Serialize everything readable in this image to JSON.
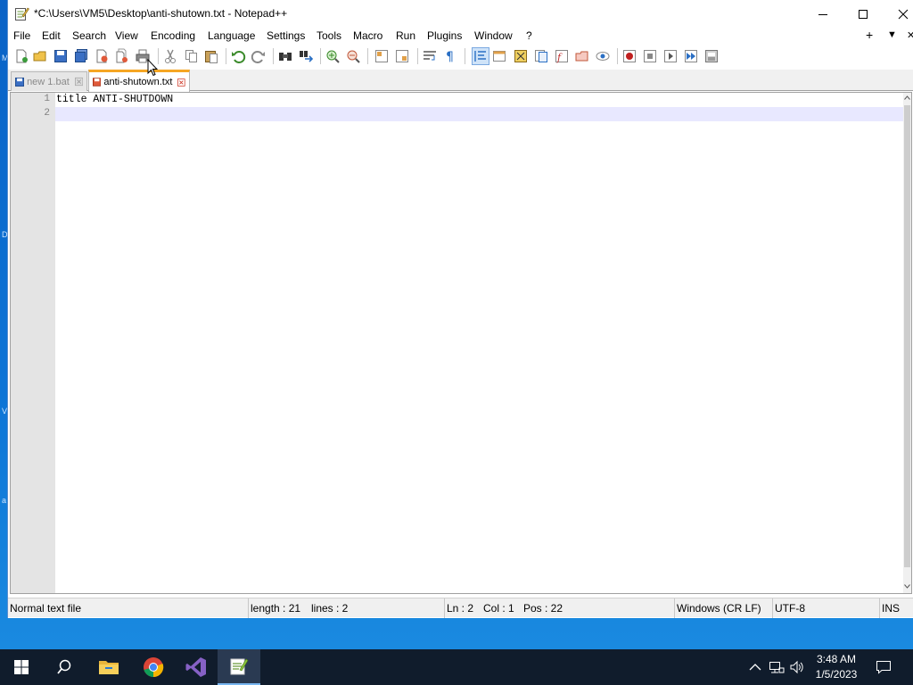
{
  "window": {
    "title": "*C:\\Users\\VM5\\Desktop\\anti-shutown.txt - Notepad++",
    "controls": {
      "minimize": "minimize",
      "maximize": "maximize",
      "close": "close"
    }
  },
  "menu": {
    "items": [
      "File",
      "Edit",
      "Search",
      "View",
      "Encoding",
      "Language",
      "Settings",
      "Tools",
      "Macro",
      "Run",
      "Plugins",
      "Window",
      "?"
    ],
    "right_plus": "+",
    "right_dropdown": "▼",
    "right_close": "✕"
  },
  "toolbar": {
    "icons": [
      "new-file-icon",
      "open-file-icon",
      "save-icon",
      "save-all-icon",
      "close-icon",
      "close-all-icon",
      "print-icon",
      "cut-icon",
      "copy-icon",
      "paste-icon",
      "undo-icon",
      "redo-icon",
      "find-icon",
      "replace-icon",
      "zoom-in-icon",
      "zoom-out-icon",
      "sync-vertical-icon",
      "sync-horizontal-icon",
      "word-wrap-icon",
      "show-all-characters-icon",
      "indent-guide-icon",
      "user-defined-language-icon",
      "document-map-icon",
      "document-list-icon",
      "function-list-icon",
      "folder-as-workspace-icon",
      "monitoring-icon",
      "record-macro-icon",
      "stop-recording-icon",
      "playback-macro-icon",
      "run-macro-multiple-icon",
      "save-macro-icon"
    ]
  },
  "tabs": [
    {
      "label": "new 1.bat",
      "active": false
    },
    {
      "label": "anti-shutown.txt",
      "active": true
    }
  ],
  "editor": {
    "lines": [
      {
        "number": "1",
        "text": "title ANTI-SHUTDOWN"
      },
      {
        "number": "2",
        "text": ""
      }
    ],
    "current_line": 2
  },
  "status": {
    "file_type": "Normal text file",
    "length": "length : 21",
    "lines": "lines : 2",
    "ln": "Ln : 2",
    "col": "Col : 1",
    "pos": "Pos : 22",
    "eol": "Windows (CR LF)",
    "encoding": "UTF-8",
    "mode": "INS"
  },
  "taskbar": {
    "apps": [
      "start-icon",
      "search-icon",
      "file-explorer-icon",
      "chrome-icon",
      "visual-studio-icon",
      "notepadpp-icon"
    ],
    "active_app": "notepadpp-icon",
    "tray": [
      "chevron-up-icon",
      "network-icon",
      "volume-icon",
      "notification-icon"
    ],
    "time": "3:48 AM",
    "date": "1/5/2023"
  },
  "colors": {
    "desktop": "#0c74d6",
    "taskbar": "#101c2c",
    "active_tab_accent": "#f6a623",
    "current_line": "#e8e8ff",
    "gutter": "#e4e4e4"
  }
}
